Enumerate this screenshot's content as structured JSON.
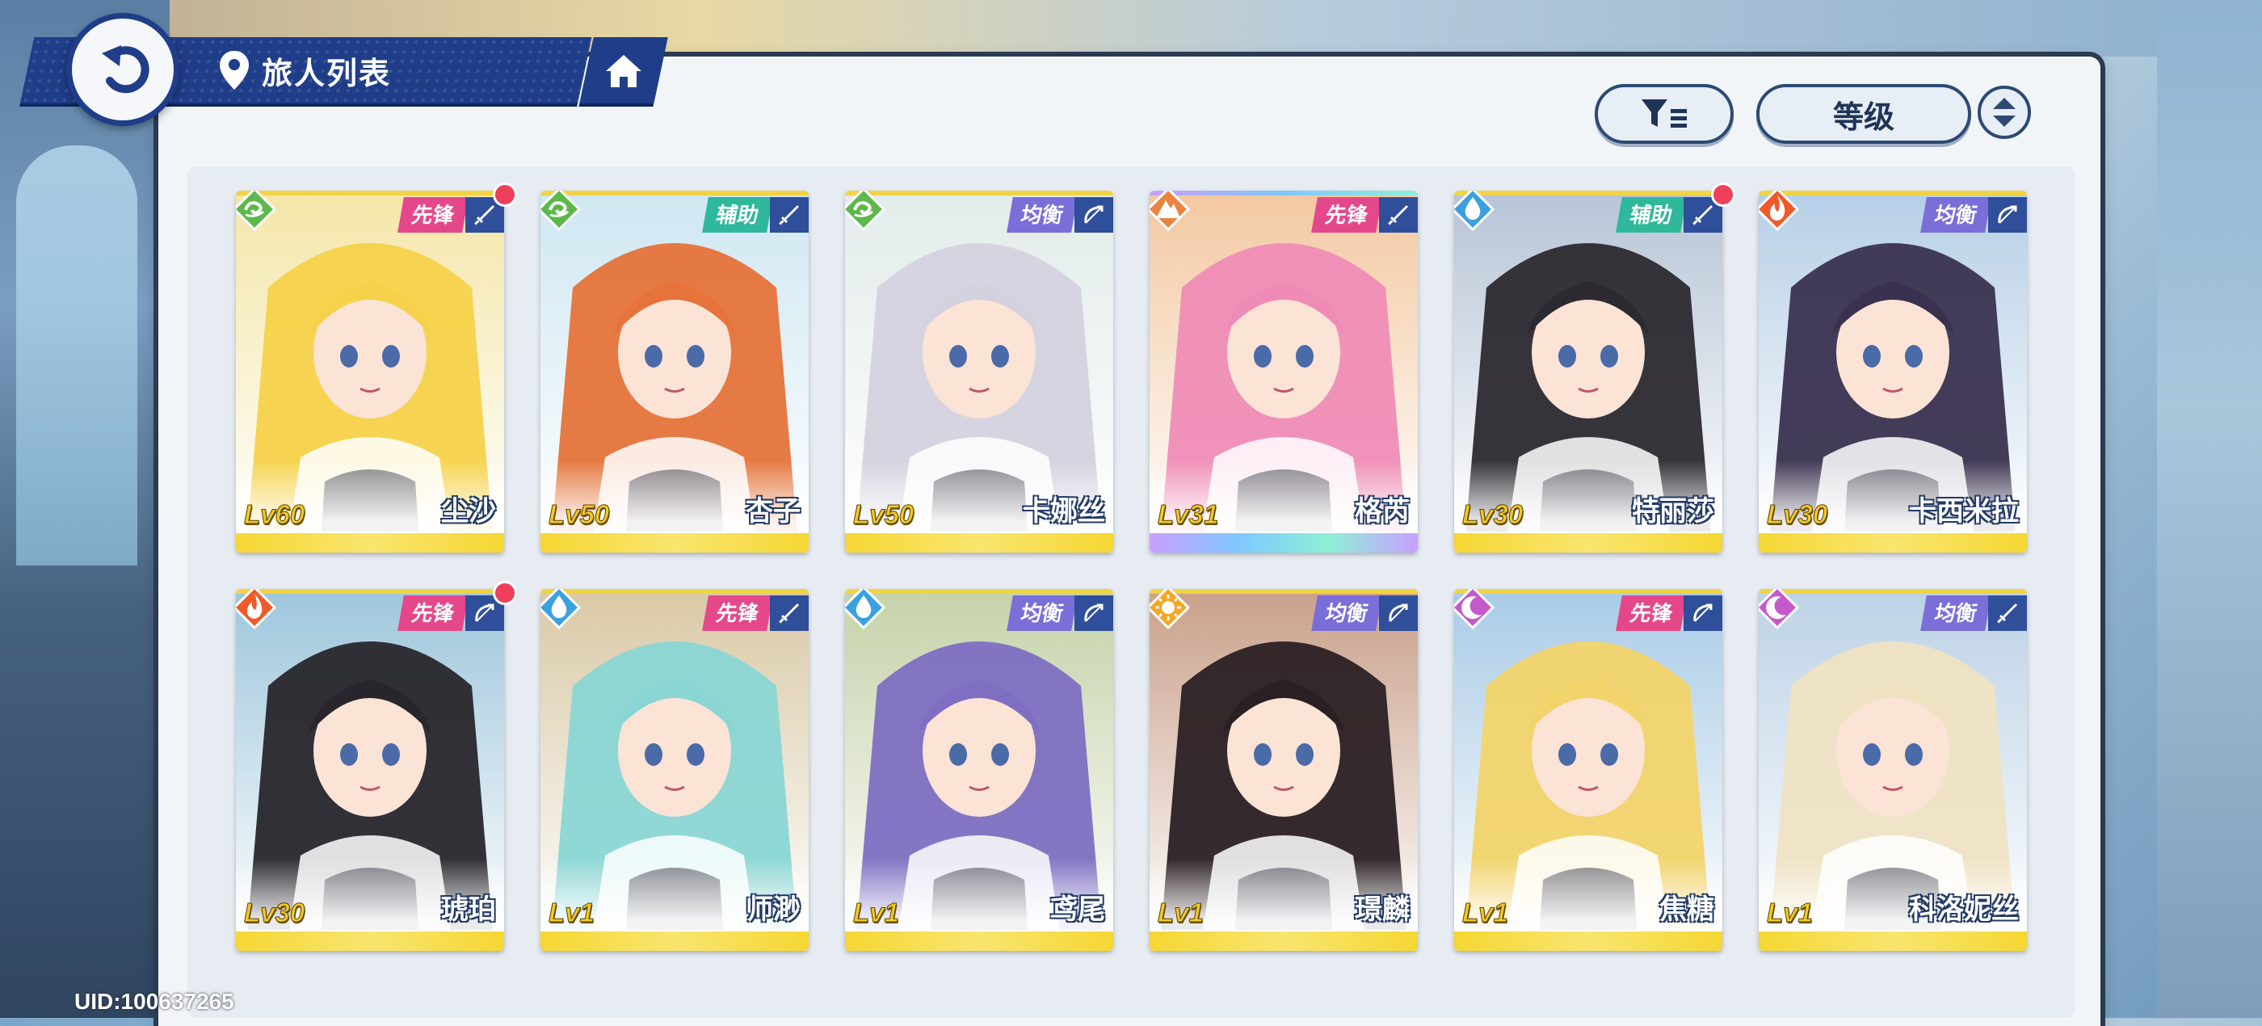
{
  "header": {
    "title": "旅人列表"
  },
  "controls": {
    "sort_label": "等级"
  },
  "uid_text": "UID:100637265",
  "colors": {
    "vanguard": "#e5488a",
    "support": "#2fb89b",
    "balance": "#7a6ed9",
    "wind": "#5cb84a",
    "water": "#3ba0e0",
    "fire": "#f05a2a",
    "earth": "#e88440",
    "light": "#f5a623",
    "dark": "#c45ac9"
  },
  "characters": [
    {
      "name": "尘沙",
      "level": "Lv60",
      "role": "先锋",
      "element": "wind-icon",
      "weapon": "sword-icon",
      "new": true,
      "hair": "#f6d24a",
      "bg": "#f4e6a8"
    },
    {
      "name": "杏子",
      "level": "Lv50",
      "role": "辅助",
      "element": "wind-icon",
      "weapon": "sword-icon",
      "new": false,
      "hair": "#e5733a",
      "bg": "#cfe7f2"
    },
    {
      "name": "卡娜丝",
      "level": "Lv50",
      "role": "均衡",
      "element": "wind-icon",
      "weapon": "bow-icon",
      "new": false,
      "hair": "#d4d2de",
      "bg": "#e2ecea"
    },
    {
      "name": "格芮",
      "level": "Lv31",
      "role": "先锋",
      "element": "earth-icon",
      "weapon": "sword-icon",
      "new": false,
      "hair": "#ef8cb6",
      "bg": "#f3c8a1"
    },
    {
      "name": "特丽莎",
      "level": "Lv30",
      "role": "辅助",
      "element": "water-icon",
      "weapon": "sword-icon",
      "new": true,
      "hair": "#2c2a30",
      "bg": "#b7c4d6"
    },
    {
      "name": "卡西米拉",
      "level": "Lv30",
      "role": "均衡",
      "element": "fire-icon",
      "weapon": "bow-icon",
      "new": false,
      "hair": "#3a3150",
      "bg": "#b6cfe6"
    },
    {
      "name": "琥珀",
      "level": "Lv30",
      "role": "先锋",
      "element": "fire-icon",
      "weapon": "bow-icon",
      "new": true,
      "hair": "#28262c",
      "bg": "#9ec6dc"
    },
    {
      "name": "师渺",
      "level": "Lv1",
      "role": "先锋",
      "element": "water-icon",
      "weapon": "sword-icon",
      "new": false,
      "hair": "#8ad6d4",
      "bg": "#d9c9a6"
    },
    {
      "name": "鸢尾",
      "level": "Lv1",
      "role": "均衡",
      "element": "water-icon",
      "weapon": "bow-icon",
      "new": false,
      "hair": "#7e6fc2",
      "bg": "#c5d2a9"
    },
    {
      "name": "璟麟",
      "level": "Lv1",
      "role": "均衡",
      "element": "light-icon",
      "weapon": "bow-icon",
      "new": false,
      "hair": "#2a2024",
      "bg": "#c9a08a"
    },
    {
      "name": "焦糖",
      "level": "Lv1",
      "role": "先锋",
      "element": "dark-icon",
      "weapon": "bow-icon",
      "new": false,
      "hair": "#f2d46a",
      "bg": "#a9cbe6"
    },
    {
      "name": "科洛妮丝",
      "level": "Lv1",
      "role": "均衡",
      "element": "dark-icon",
      "weapon": "sword-icon",
      "new": false,
      "hair": "#efe3c4",
      "bg": "#bcd2e6"
    }
  ]
}
